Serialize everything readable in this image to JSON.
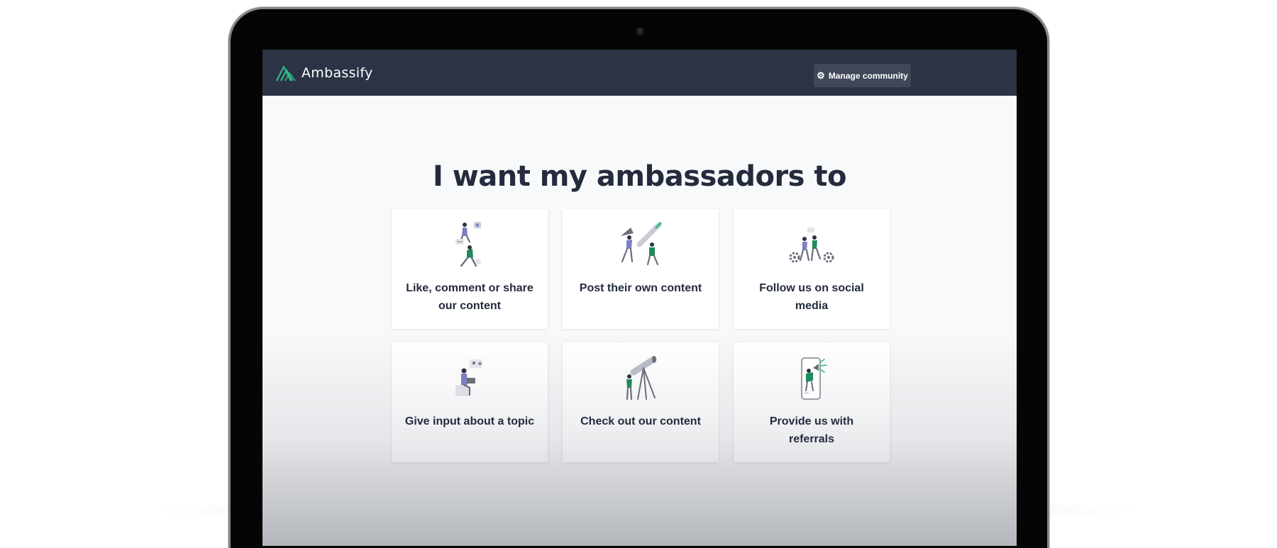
{
  "app": {
    "brand_name": "Ambassify",
    "manage_button_label": "Manage community",
    "manage_button_icon": "gear-icon"
  },
  "main": {
    "heading": "I want my ambassadors to",
    "cards": [
      {
        "label": "Like, comment or share our content",
        "icon": "social-engagement-illustration"
      },
      {
        "label": "Post their own content",
        "icon": "create-post-illustration"
      },
      {
        "label": "Follow us on social media",
        "icon": "cycling-gears-illustration"
      },
      {
        "label": "Give input about a topic",
        "icon": "laptop-feedback-illustration"
      },
      {
        "label": "Check out our content",
        "icon": "telescope-illustration"
      },
      {
        "label": "Provide us with referrals",
        "icon": "megaphone-phone-illustration"
      }
    ]
  },
  "colors": {
    "navbar": "#2b3345",
    "accent": "#2fb889",
    "heading": "#232b3d",
    "illustration_green": "#1f8a5b",
    "illustration_purple": "#7b7fc4"
  }
}
